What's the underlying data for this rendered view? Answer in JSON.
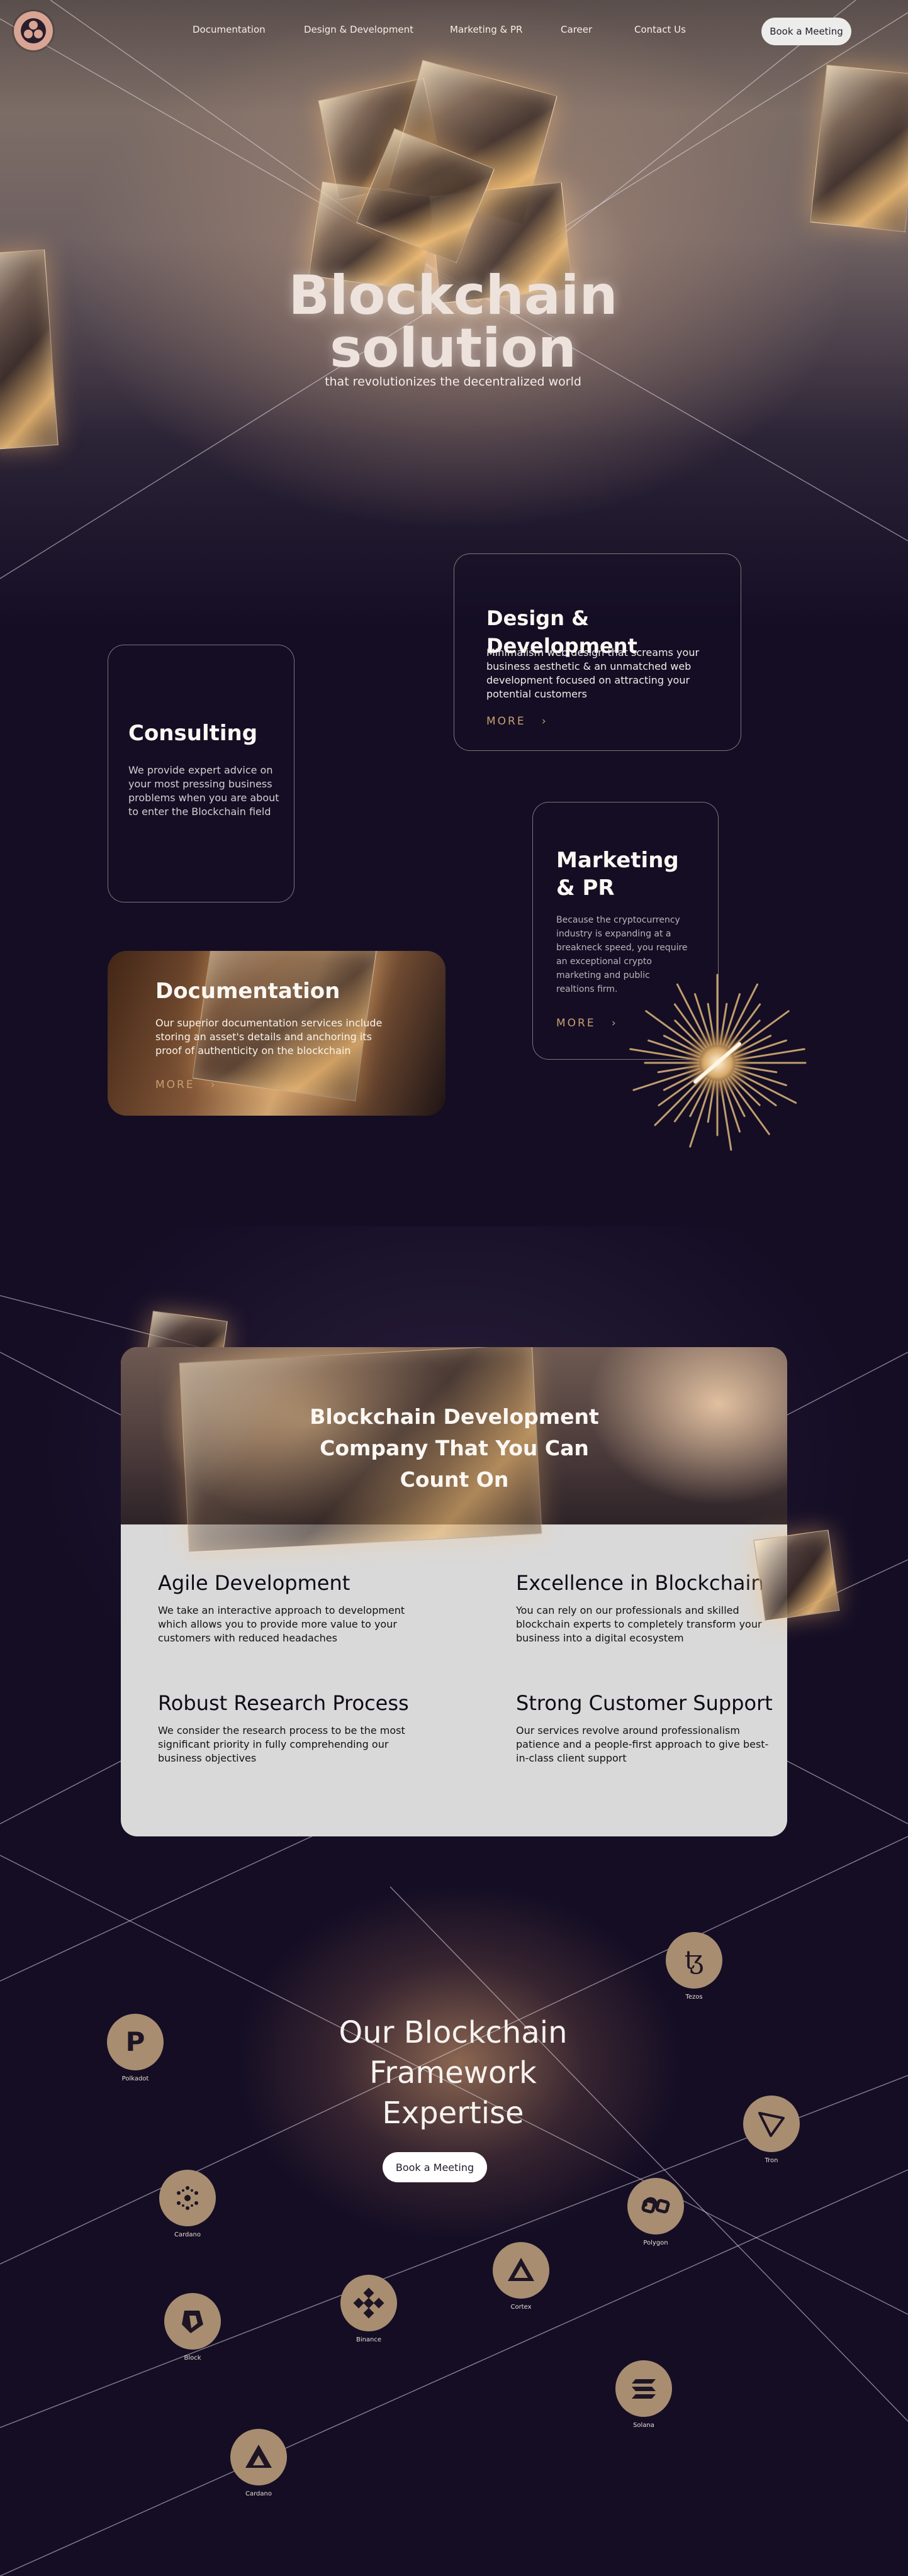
{
  "nav": {
    "links": [
      "Documentation",
      "Design & Development",
      "Marketing & PR",
      "Career",
      "Contact Us"
    ],
    "cta": "Book a Meeting"
  },
  "hero": {
    "title_line1": "Blockchain",
    "title_line2": "solution",
    "subtitle": "that revolutionizes the decentralized world"
  },
  "services": {
    "design": {
      "title": "Design & Development",
      "text": "Minimalism web design that screams your business aesthetic & an unmatched web development focused on attracting your potential customers",
      "more": "MORE"
    },
    "consulting": {
      "title": "Consulting",
      "text": "We provide expert advice on your most pressing business problems when you are about to enter the Blockchain field"
    },
    "marketing": {
      "title": "Marketing & PR",
      "text": "Because the cryptocurrency industry is expanding at a breakneck speed, you require an exceptional crypto marketing and public realtions firm.",
      "more": "MORE"
    },
    "documentation": {
      "title": "Documentation",
      "text": "Our superior documentation services include storing an asset's details and anchoring its proof of authenticity on the blockchain",
      "more": "MORE"
    }
  },
  "company": {
    "heading": "Blockchain Development Company That You Can Count On",
    "features": [
      {
        "title": "Agile Development",
        "text": "We take an interactive approach to development which allows you to provide more value to your customers with reduced headaches"
      },
      {
        "title": "Excellence in Blockchain",
        "text": "You can rely on our professionals and skilled blockchain experts to completely transform your business into a digital ecosystem"
      },
      {
        "title": "Robust Research Process",
        "text": "We consider the research process to be the most significant priority in fully comprehending our business objectives"
      },
      {
        "title": "Strong Customer Support",
        "text": "Our services revolve around professionalism patience and a people-first approach to give best-in-class client support"
      }
    ]
  },
  "framework": {
    "title": "Our Blockchain Framework Expertise",
    "cta": "Book a Meeting",
    "coins": [
      {
        "label": "Tezos",
        "icon": "tezos-icon"
      },
      {
        "label": "Polkadot",
        "icon": "polkadot-icon"
      },
      {
        "label": "Tron",
        "icon": "tron-icon"
      },
      {
        "label": "Cardano",
        "icon": "cardano-icon"
      },
      {
        "label": "Polygon",
        "icon": "polygon-icon"
      },
      {
        "label": "Cortex",
        "icon": "cortex-icon"
      },
      {
        "label": "Binance",
        "icon": "binance-icon"
      },
      {
        "label": "Block",
        "icon": "block-icon"
      },
      {
        "label": "Solana",
        "icon": "solana-icon"
      },
      {
        "label": "Cardano",
        "icon": "cardano-alt-icon"
      }
    ]
  },
  "colors": {
    "background": "#140d24",
    "accent_gold": "#c8a06e",
    "coin": "#a88d71",
    "panel": "#d9d9d9",
    "logo": "#d9a493"
  }
}
